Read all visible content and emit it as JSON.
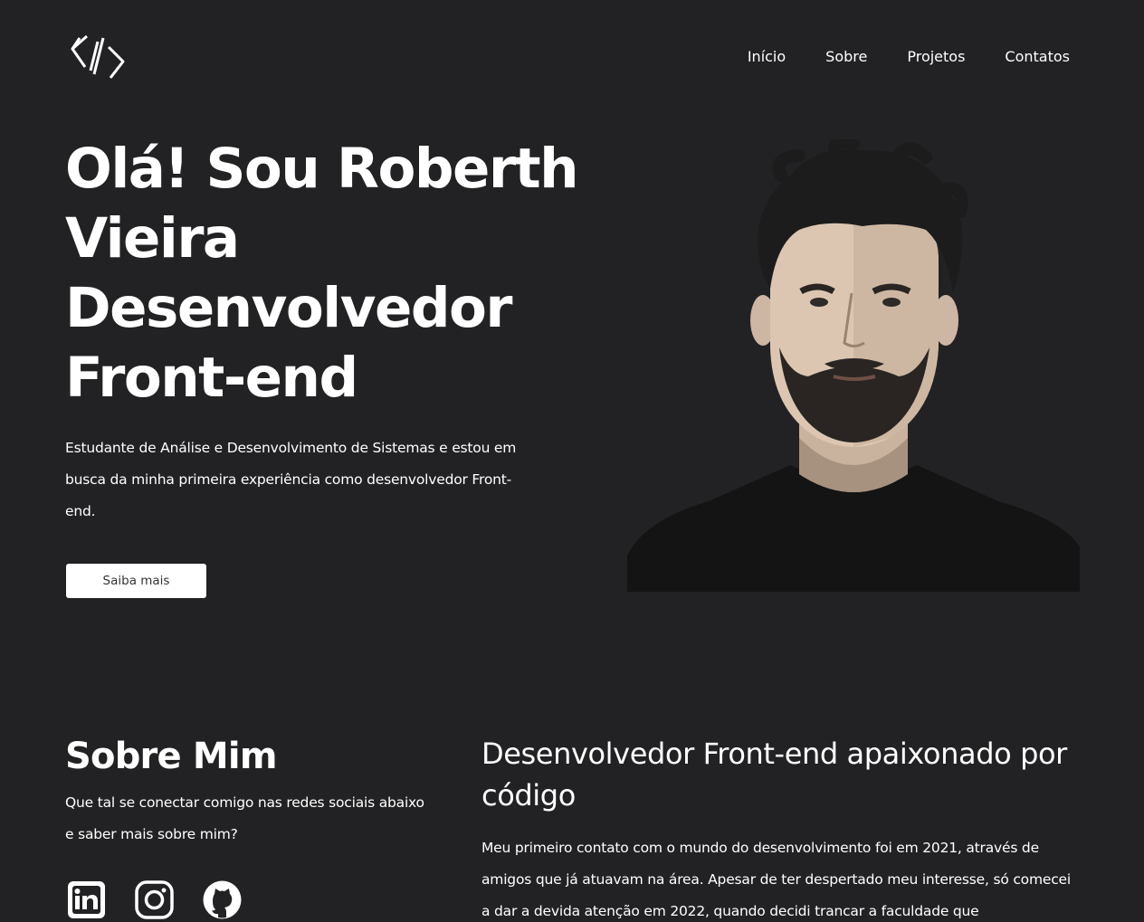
{
  "header": {
    "logo_icon": "code-brackets-logo-icon",
    "nav": [
      {
        "label": "Início"
      },
      {
        "label": "Sobre"
      },
      {
        "label": "Projetos"
      },
      {
        "label": "Contatos"
      }
    ]
  },
  "hero": {
    "title_lines": [
      "Olá! Sou Roberth",
      "Vieira",
      "Desenvolvedor",
      "Front-end"
    ],
    "description": "Estudante de Análise e Desenvolvimento de Sistemas e estou em busca da minha primeira experiência como desenvolvedor Front-end.",
    "button_label": "Saiba mais",
    "portrait_icon": "developer-portrait-illustration"
  },
  "about": {
    "title": "Sobre Mim",
    "subtitle": "Que tal se conectar comigo nas redes sociais abaixo e saber mais sobre mim?",
    "social_icons": [
      "linkedin-icon",
      "instagram-icon",
      "github-icon"
    ],
    "heading": "Desenvolvedor Front-end apaixonado por código",
    "text": "Meu primeiro contato com o mundo do desenvolvimento foi em 2021, através de amigos que já atuavam na área. Apesar de ter despertado meu interesse, só comecei a dar a devida atenção em 2022, quando decidi trancar a faculdade que"
  },
  "colors": {
    "background": "#222224",
    "text": "#ffffff",
    "button_bg": "#ffffff",
    "button_text": "#333333"
  }
}
